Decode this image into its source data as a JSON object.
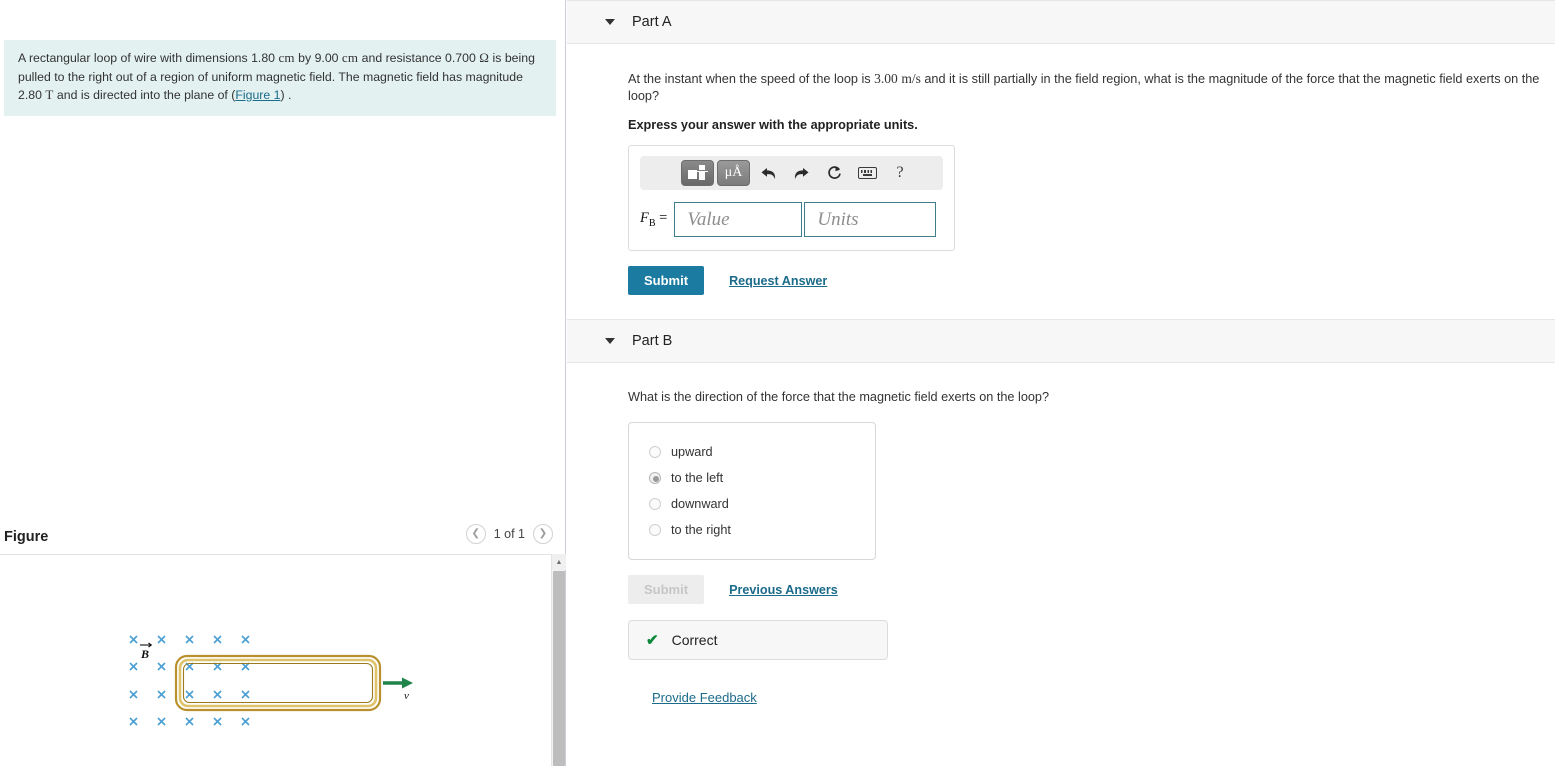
{
  "problem": {
    "text_part1": "A rectangular loop of wire with dimensions ",
    "dim1": "1.80",
    "unit_cm1": "cm",
    "text_by": " by ",
    "dim2": "9.00",
    "unit_cm2": "cm",
    "text_res": " and resistance ",
    "resistance": "0.700",
    "unit_ohm": "Ω",
    "text_part2": " is being pulled to the right out of a region of uniform magnetic field. The magnetic field has magnitude ",
    "field": "2.80",
    "unit_t": "T",
    "text_part3": " and is directed into the plane of (",
    "figure_link": "Figure 1",
    "text_part4": ") ."
  },
  "figure": {
    "title": "Figure",
    "pagination": "1 of 1",
    "prev_icon": "chevron-left-icon",
    "next_icon": "chevron-right-icon",
    "b_label": "B",
    "v_label": "v",
    "field_symbol": "×",
    "field_color": "#4a9fd4",
    "loop_color": "#c9a227",
    "arrow_color": "#1e8449",
    "cross_rows": 4,
    "cross_cols": 5
  },
  "partA": {
    "label": "Part A",
    "caret_icon": "caret-down-icon",
    "question_pre": "At the instant when the speed of the loop is ",
    "speed": "3.00",
    "speed_unit": "m/s",
    "question_post": " and it is still partially in the field region, what is the magnitude of the force that the magnetic field exerts on the loop?",
    "express": "Express your answer with the appropriate units.",
    "toolbar": {
      "template_icon": "math-template-icon",
      "units_icon": "micro-angstrom-units-icon",
      "units_text": "μÅ",
      "undo_icon": "undo-icon",
      "redo_icon": "redo-icon",
      "reset_icon": "reset-icon",
      "keyboard_icon": "keyboard-icon",
      "help_icon": "help-icon",
      "help_text": "?"
    },
    "field_label": "F",
    "field_sub": "B",
    "field_eq": "=",
    "value_placeholder": "Value",
    "value_current": "",
    "units_placeholder": "Units",
    "units_current": "",
    "submit_label": "Submit",
    "request_label": "Request Answer"
  },
  "partB": {
    "label": "Part B",
    "caret_icon": "caret-down-icon",
    "question": "What is the direction of the force that the magnetic field exerts on the loop?",
    "options": [
      {
        "label": "upward",
        "selected": false
      },
      {
        "label": "to the left",
        "selected": true
      },
      {
        "label": "downward",
        "selected": false
      },
      {
        "label": "to the right",
        "selected": false
      }
    ],
    "submit_label": "Submit",
    "previous_label": "Previous Answers",
    "status_icon": "check-icon",
    "status_text": "Correct",
    "status_color": "#0a8a38"
  },
  "footer": {
    "feedback_label": "Provide Feedback"
  },
  "colors": {
    "accent": "#1b7ba0",
    "link": "#1b6b8a",
    "problem_bg": "#e3f1f0",
    "header_bg": "#f7f7f7"
  }
}
